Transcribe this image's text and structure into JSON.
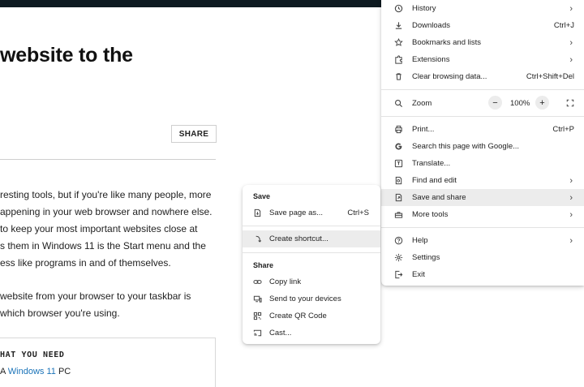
{
  "article": {
    "headline": "website to the",
    "share_label": "SHARE",
    "body_lines": [
      "resting tools, but if you're like many people, more",
      "appening in your web browser and nowhere else.",
      "to keep your most important websites close at",
      "s them in Windows 11 is the Start menu and the",
      "ess like programs in and of themselves.",
      "website from your browser to your taskbar is",
      "which browser you're using."
    ],
    "need_title": "HAT YOU NEED",
    "need_item_prefix": "A ",
    "need_item_link": "Windows 11",
    "need_item_suffix": " PC"
  },
  "main_menu": {
    "history": "History",
    "downloads": "Downloads",
    "downloads_shortcut": "Ctrl+J",
    "bookmarks": "Bookmarks and lists",
    "extensions": "Extensions",
    "clear": "Clear browsing data...",
    "clear_shortcut": "Ctrl+Shift+Del",
    "zoom": "Zoom",
    "zoom_minus": "−",
    "zoom_value": "100%",
    "zoom_plus": "+",
    "print": "Print...",
    "print_shortcut": "Ctrl+P",
    "search_google": "Search this page with Google...",
    "translate": "Translate...",
    "find_edit": "Find and edit",
    "save_share": "Save and share",
    "more_tools": "More tools",
    "help": "Help",
    "settings": "Settings",
    "exit": "Exit",
    "chevron": "›"
  },
  "sub_menu": {
    "save_header": "Save",
    "save_page": "Save page as...",
    "save_page_shortcut": "Ctrl+S",
    "create_shortcut": "Create shortcut...",
    "share_header": "Share",
    "copy_link": "Copy link",
    "send_devices": "Send to your devices",
    "qr_code": "Create QR Code",
    "cast": "Cast..."
  }
}
